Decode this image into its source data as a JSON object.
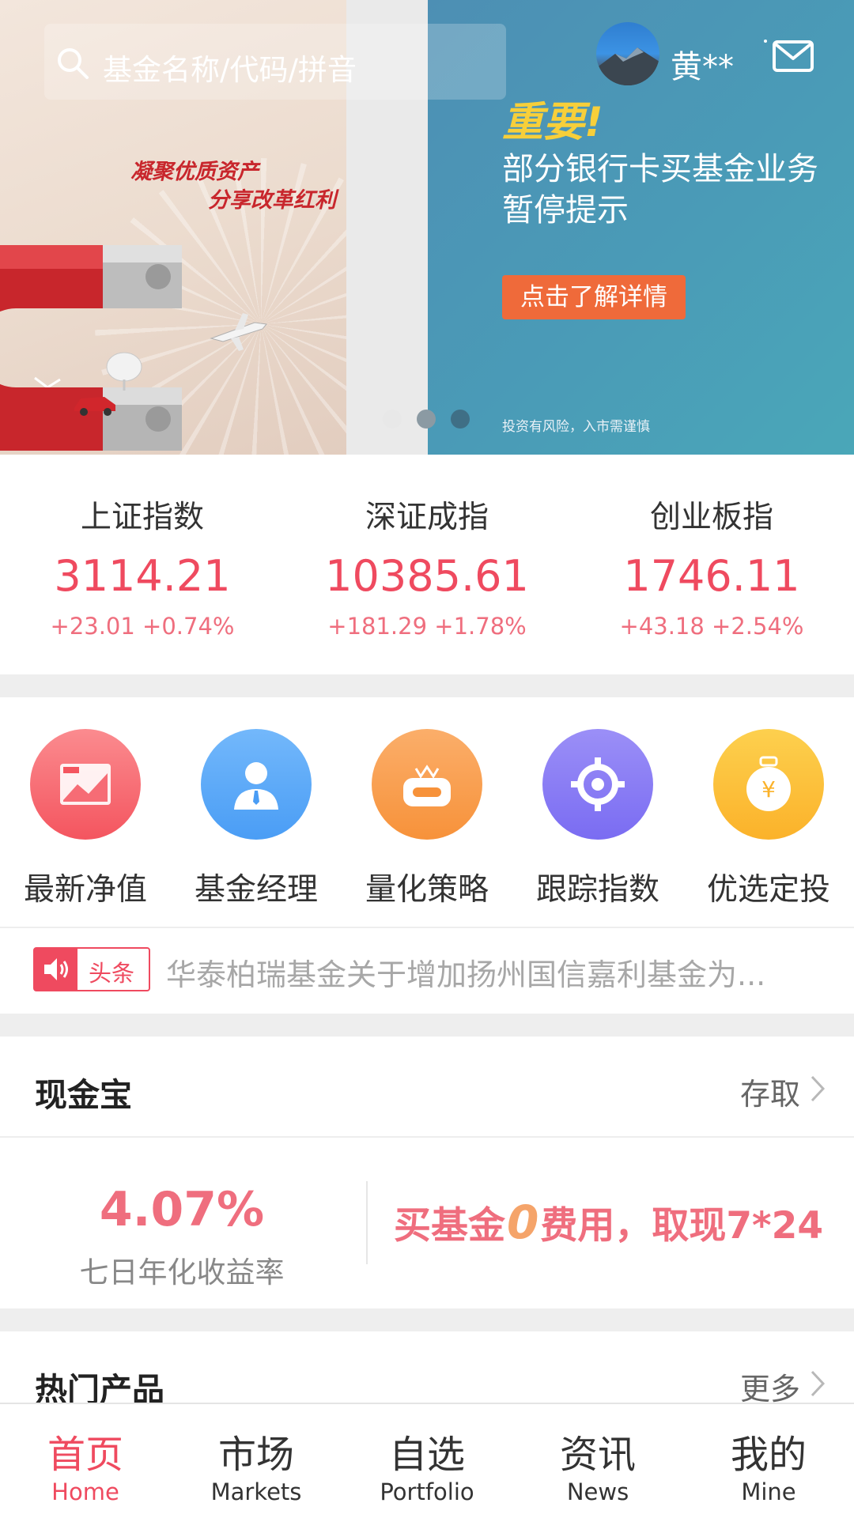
{
  "header": {
    "search_placeholder": "基金名称/代码/拼音",
    "username": "黄**"
  },
  "banner": {
    "slide_left": {
      "slogan_line1": "凝聚优质资产",
      "slogan_line2": "分享改革红利"
    },
    "slide_right": {
      "title": "重要!",
      "body_line1": "部分银行卡买基金业务",
      "body_line2": "暂停提示",
      "button": "点击了解详情",
      "risk": "投资有风险，入市需谨慎"
    },
    "pager": {
      "count": 3,
      "active": 3
    }
  },
  "indices": [
    {
      "name": "上证指数",
      "value": "3114.21",
      "change": "+23.01  +0.74%"
    },
    {
      "name": "深证成指",
      "value": "10385.61",
      "change": "+181.29  +1.78%"
    },
    {
      "name": "创业板指",
      "value": "1746.11",
      "change": "+43.18  +2.54%"
    }
  ],
  "shortcuts": [
    {
      "label": "最新净值",
      "icon": "chart-card-icon",
      "color": "#f4555f"
    },
    {
      "label": "基金经理",
      "icon": "manager-icon",
      "color": "#4a9df5"
    },
    {
      "label": "量化策略",
      "icon": "robot-icon",
      "color": "#f7923a"
    },
    {
      "label": "跟踪指数",
      "icon": "target-icon",
      "color": "#7a6cf2"
    },
    {
      "label": "优选定投",
      "icon": "money-bag-icon",
      "color": "#fbb22a"
    }
  ],
  "headline": {
    "tag": "头条",
    "text": "华泰柏瑞基金关于增加扬州国信嘉利基金为..."
  },
  "cash": {
    "title": "现金宝",
    "link": "存取",
    "rate": "4.07%",
    "rate_label": "七日年化收益率",
    "promo_prefix": "买基金",
    "promo_zero": "0",
    "promo_suffix": "费用，取现7*24"
  },
  "hot": {
    "title": "热门产品",
    "link": "更多"
  },
  "tabs": [
    {
      "cn": "首页",
      "en": "Home",
      "active": true
    },
    {
      "cn": "市场",
      "en": "Markets",
      "active": false
    },
    {
      "cn": "自选",
      "en": "Portfolio",
      "active": false
    },
    {
      "cn": "资讯",
      "en": "News",
      "active": false
    },
    {
      "cn": "我的",
      "en": "Mine",
      "active": false
    }
  ],
  "colors": {
    "accent": "#ef4a5f",
    "up": "#ef6e7e",
    "banner_blue": "#4a9bb7",
    "banner_orange": "#ef6a3a"
  }
}
